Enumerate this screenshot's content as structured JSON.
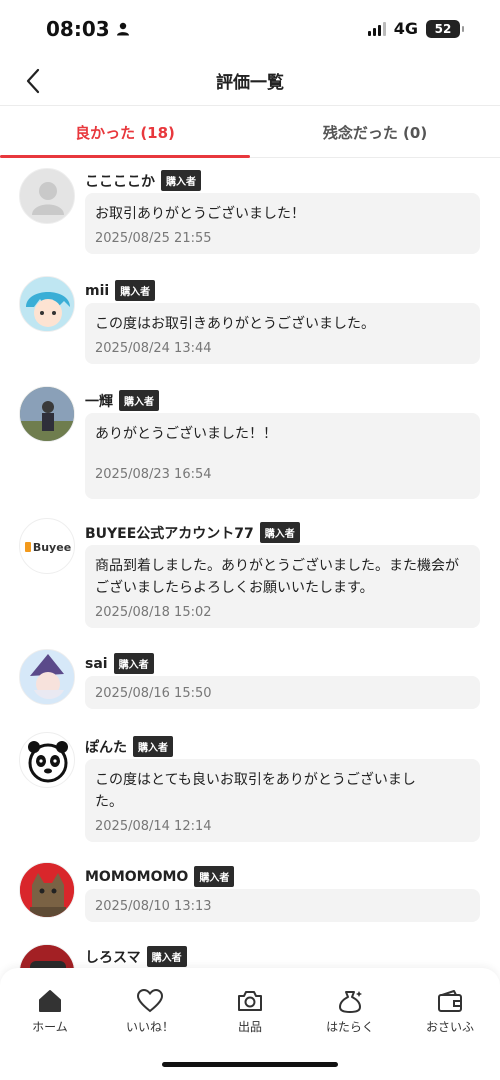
{
  "status": {
    "time": "08:03",
    "network": "4G",
    "battery": "52"
  },
  "header": {
    "title": "評価一覧"
  },
  "tabs": [
    {
      "label": "良かった (18)"
    },
    {
      "label": "残念だった (0)"
    }
  ],
  "reviews": [
    {
      "name": "ここここか",
      "badge": "購入者",
      "comment": "お取引ありがとうございました！",
      "date": "2025/08/25 21:55"
    },
    {
      "name": "mii",
      "badge": "購入者",
      "comment": "この度はお取引きありがとうございました。",
      "date": "2025/08/24 13:44"
    },
    {
      "name": "一輝",
      "badge": "購入者",
      "comment": "ありがとうございました！！",
      "date": "2025/08/23 16:54"
    },
    {
      "name": "BUYEE公式アカウント77",
      "badge": "購入者",
      "comment": "商品到着しました。ありがとうございました。また機会がございましたらよろしくお願いいたします。",
      "date": "2025/08/18 15:02",
      "avatar_text": "Buyee"
    },
    {
      "name": "sai",
      "badge": "購入者",
      "comment": "",
      "date": "2025/08/16 15:50"
    },
    {
      "name": "ぽんた",
      "badge": "購入者",
      "comment": "この度はとても良いお取引をありがとうございました。",
      "date": "2025/08/14 12:14"
    },
    {
      "name": "MOMOMOMO",
      "badge": "購入者",
      "comment": "",
      "date": "2025/08/10 13:13"
    },
    {
      "name": "しろスマ",
      "badge": "購入者",
      "comment": "",
      "date": ""
    }
  ],
  "bottom_nav": [
    {
      "label": "ホーム",
      "icon": "home-icon"
    },
    {
      "label": "いいね！",
      "icon": "heart-icon"
    },
    {
      "label": "出品",
      "icon": "camera-icon"
    },
    {
      "label": "はたらく",
      "icon": "money-bag-icon"
    },
    {
      "label": "おさいふ",
      "icon": "wallet-icon"
    }
  ],
  "colors": {
    "accent": "#e8383d",
    "badge_bg": "#2b2b2b",
    "bubble_bg": "#f3f3f3"
  }
}
